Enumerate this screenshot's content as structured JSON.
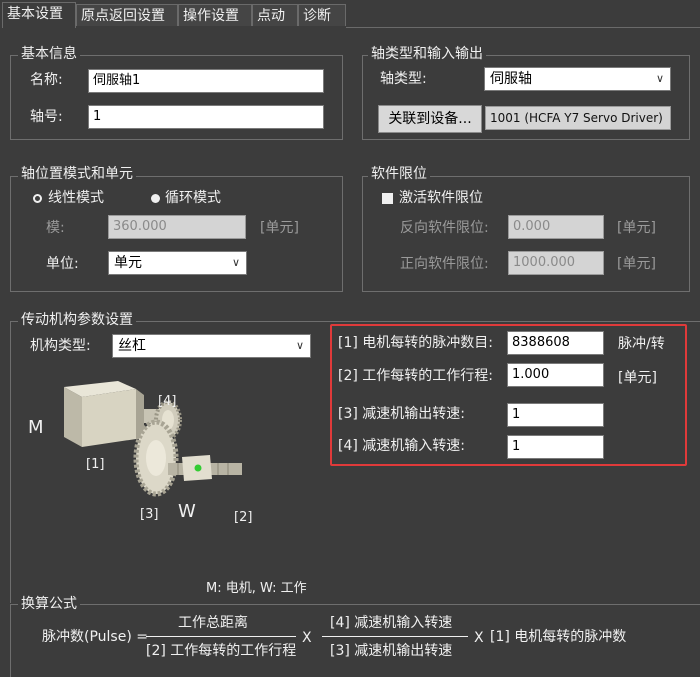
{
  "tabs": [
    "基本设置",
    "原点返回设置",
    "操作设置",
    "点动",
    "诊断"
  ],
  "basic_info": {
    "title": "基本信息",
    "name_label": "名称:",
    "name_value": "伺服轴1",
    "axis_label": "轴号:",
    "axis_value": "1"
  },
  "axis_type": {
    "title": "轴类型和输入输出",
    "type_label": "轴类型:",
    "type_value": "伺服轴",
    "link_button": "关联到设备...",
    "device_value": "1001 (HCFA Y7 Servo Driver)"
  },
  "position_mode": {
    "title": "轴位置模式和单元",
    "linear_label": "线性模式",
    "cyclic_label": "循环模式",
    "selected": "cyclic",
    "modulus_label": "模:",
    "modulus_value": "360.000",
    "modulus_unit": "[单元]",
    "unit_label": "单位:",
    "unit_value": "单元"
  },
  "soft_limit": {
    "title": "软件限位",
    "enable_label": "激活软件限位",
    "reverse_label": "反向软件限位:",
    "reverse_value": "0.000",
    "reverse_unit": "[单元]",
    "forward_label": "正向软件限位:",
    "forward_value": "1000.000",
    "forward_unit": "[单元]"
  },
  "transmission": {
    "title": "传动机构参数设置",
    "mech_label": "机构类型:",
    "mech_value": "丝杠",
    "p1_label": "[1] 电机每转的脉冲数目:",
    "p1_value": "8388608",
    "p1_unit": "脉冲/转",
    "p2_label": "[2] 工作每转的工作行程:",
    "p2_value": "1.000",
    "p2_unit": "[单元]",
    "p3_label": "[3] 减速机输出转速:",
    "p3_value": "1",
    "p4_label": "[4] 减速机输入转速:",
    "p4_value": "1",
    "diagram": {
      "m": "M",
      "w": "W",
      "l1": "[1]",
      "l2": "[2]",
      "l3": "[3]",
      "l4": "[4]"
    },
    "legend": "M: 电机, W: 工作"
  },
  "formula": {
    "title": "换算公式",
    "lhs": "脉冲数(Pulse) =",
    "num1": "工作总距离",
    "den1": "[2] 工作每转的工作行程",
    "times1": "X",
    "num2": "[4] 减速机输入转速",
    "den2": "[3] 减速机输出转速",
    "times2": "X",
    "tail": "[1] 电机每转的脉冲数"
  },
  "colors": {
    "background": "#3c3c3c",
    "highlight": "#e03a3a",
    "indicator": "#33cc33"
  }
}
